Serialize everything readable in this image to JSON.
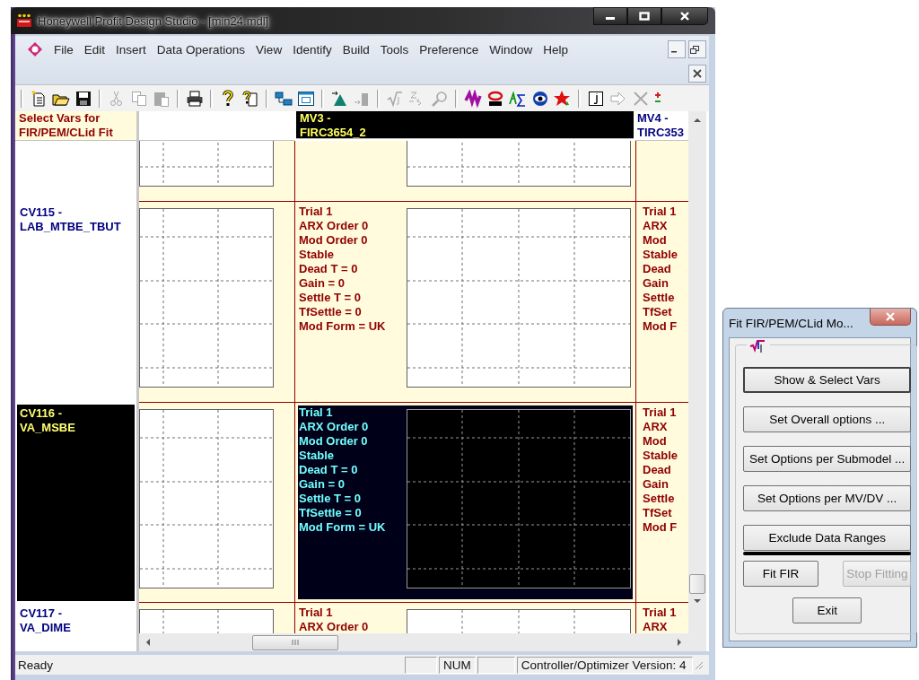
{
  "window": {
    "title": "Honeywell Profit Design Studio - [min24.mdl]"
  },
  "menu": [
    "File",
    "Edit",
    "Insert",
    "Data Operations",
    "View",
    "Identify",
    "Build",
    "Tools",
    "Preference",
    "Window",
    "Help"
  ],
  "toolbar": [
    [
      {
        "kind": "new",
        "disabled": false
      },
      {
        "kind": "open",
        "disabled": false
      },
      {
        "kind": "save",
        "disabled": false
      }
    ],
    [
      {
        "kind": "cut",
        "disabled": true
      },
      {
        "kind": "copy",
        "disabled": true
      },
      {
        "kind": "paste",
        "disabled": true
      }
    ],
    [
      {
        "kind": "print",
        "disabled": false
      }
    ],
    [
      {
        "kind": "help",
        "disabled": false
      },
      {
        "kind": "context_help",
        "disabled": false
      }
    ],
    [
      {
        "kind": "tile",
        "disabled": false
      },
      {
        "kind": "window",
        "disabled": false
      }
    ],
    [
      {
        "kind": "import",
        "disabled": false
      },
      {
        "kind": "export",
        "disabled": true
      }
    ],
    [
      {
        "kind": "root",
        "disabled": true
      },
      {
        "kind": "squiggle",
        "disabled": true
      },
      {
        "kind": "probe",
        "disabled": true
      }
    ],
    [
      {
        "kind": "coil",
        "disabled": false
      },
      {
        "kind": "ring",
        "disabled": false
      },
      {
        "kind": "zigzag",
        "disabled": false
      },
      {
        "kind": "eye",
        "disabled": false
      },
      {
        "kind": "star",
        "disabled": false
      }
    ],
    [
      {
        "kind": "box",
        "disabled": false
      },
      {
        "kind": "arrow",
        "disabled": true
      },
      {
        "kind": "delete",
        "disabled": true
      },
      {
        "kind": "plus_minus",
        "disabled": false
      }
    ]
  ],
  "grid": {
    "corner": [
      "Select Vars for",
      "FIR/PEM/CLid Fit"
    ],
    "columns": [
      {
        "selected": false
      },
      {
        "header": [
          "MV3 -",
          "FIRC3654_2"
        ],
        "selected": true
      },
      {
        "header": [
          "MV4 -",
          "TIRC353"
        ],
        "selected": false
      }
    ],
    "rows": [
      {
        "selected": false,
        "cells": [
          {
            "kind": "plot"
          },
          {
            "kind": "fit"
          },
          {
            "kind": "text"
          }
        ]
      },
      {
        "label": [
          "CV115 -",
          "LAB_MTBE_TBUT"
        ],
        "selected": false,
        "cells": [
          {
            "kind": "plot"
          },
          {
            "kind": "fit",
            "lines": [
              "Trial 1",
              "ARX Order 0",
              "Mod Order 0",
              "Stable",
              "Dead T = 0",
              "Gain = 0",
              "Settle T = 0",
              "TfSettle = 0",
              "Mod Form = UK"
            ]
          },
          {
            "kind": "text",
            "lines": [
              "Trial 1",
              "ARX",
              "Mod",
              "Stable",
              "Dead",
              "Gain",
              "Settle",
              "TfSet",
              "Mod F"
            ]
          }
        ]
      },
      {
        "label": [
          "CV116 -",
          "VA_MSBE"
        ],
        "selected": true,
        "cells": [
          {
            "kind": "plot"
          },
          {
            "kind": "fit",
            "lines": [
              "Trial 1",
              "ARX Order 0",
              "Mod Order 0",
              "Stable",
              "Dead T = 0",
              "Gain = 0",
              "Settle T = 0",
              "TfSettle = 0",
              "Mod Form = UK"
            ]
          },
          {
            "kind": "text",
            "lines": [
              "Trial 1",
              "ARX",
              "Mod",
              "Stable",
              "Dead",
              "Gain",
              "Settle",
              "TfSet",
              "Mod F"
            ]
          }
        ]
      },
      {
        "label": [
          "CV117 -",
          "VA_DIME"
        ],
        "selected": false,
        "cells": [
          {
            "kind": "plot"
          },
          {
            "kind": "fit",
            "lines": [
              "Trial 1",
              "ARX Order 0"
            ]
          },
          {
            "kind": "text",
            "lines": [
              "Trial 1",
              "ARX"
            ]
          }
        ]
      }
    ]
  },
  "status_bar": {
    "text": "Ready",
    "indicator": "NUM",
    "version": "Controller/Optimizer Version: 4"
  },
  "dialog": {
    "title": "Fit FIR/PEM/CLid Mo...",
    "button_rows": [
      [
        {
          "label": "Show & Select Vars",
          "default": true,
          "disabled": false,
          "marked": false
        }
      ],
      [
        {
          "label": "Set Overall options ...",
          "default": false,
          "disabled": false,
          "marked": false
        }
      ],
      [
        {
          "label": "Set Options per Submodel ...",
          "default": false,
          "disabled": false,
          "marked": false
        }
      ],
      [
        {
          "label": "Set Options per MV/DV ...",
          "default": false,
          "disabled": false,
          "marked": false
        }
      ],
      [
        {
          "label": "Exclude Data Ranges",
          "default": false,
          "disabled": false,
          "marked": true
        }
      ],
      [
        {
          "label": "Fit FIR",
          "default": false,
          "disabled": false,
          "marked": false
        },
        {
          "label": "Stop Fitting",
          "default": false,
          "disabled": true,
          "marked": false
        }
      ],
      [
        {
          "label": "Exit",
          "default": false,
          "disabled": false,
          "marked": false
        }
      ]
    ]
  }
}
